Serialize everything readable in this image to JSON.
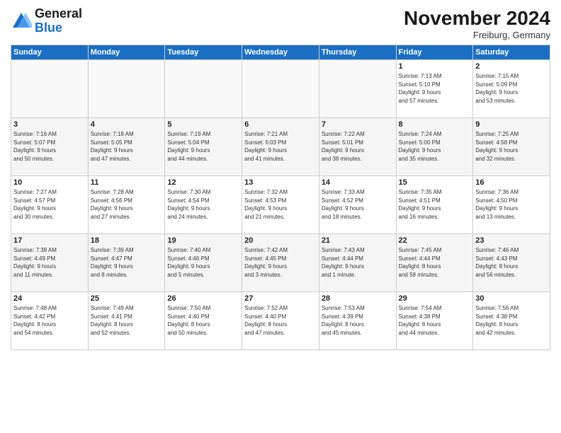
{
  "logo": {
    "line1": "General",
    "line2": "Blue"
  },
  "title": "November 2024",
  "subtitle": "Freiburg, Germany",
  "days_header": [
    "Sunday",
    "Monday",
    "Tuesday",
    "Wednesday",
    "Thursday",
    "Friday",
    "Saturday"
  ],
  "weeks": [
    [
      {
        "num": "",
        "info": ""
      },
      {
        "num": "",
        "info": ""
      },
      {
        "num": "",
        "info": ""
      },
      {
        "num": "",
        "info": ""
      },
      {
        "num": "",
        "info": ""
      },
      {
        "num": "1",
        "info": "Sunrise: 7:13 AM\nSunset: 5:10 PM\nDaylight: 9 hours\nand 57 minutes."
      },
      {
        "num": "2",
        "info": "Sunrise: 7:15 AM\nSunset: 5:09 PM\nDaylight: 9 hours\nand 53 minutes."
      }
    ],
    [
      {
        "num": "3",
        "info": "Sunrise: 7:16 AM\nSunset: 5:07 PM\nDaylight: 9 hours\nand 50 minutes."
      },
      {
        "num": "4",
        "info": "Sunrise: 7:18 AM\nSunset: 5:05 PM\nDaylight: 9 hours\nand 47 minutes."
      },
      {
        "num": "5",
        "info": "Sunrise: 7:19 AM\nSunset: 5:04 PM\nDaylight: 9 hours\nand 44 minutes."
      },
      {
        "num": "6",
        "info": "Sunrise: 7:21 AM\nSunset: 5:03 PM\nDaylight: 9 hours\nand 41 minutes."
      },
      {
        "num": "7",
        "info": "Sunrise: 7:22 AM\nSunset: 5:01 PM\nDaylight: 9 hours\nand 38 minutes."
      },
      {
        "num": "8",
        "info": "Sunrise: 7:24 AM\nSunset: 5:00 PM\nDaylight: 9 hours\nand 35 minutes."
      },
      {
        "num": "9",
        "info": "Sunrise: 7:25 AM\nSunset: 4:58 PM\nDaylight: 9 hours\nand 32 minutes."
      }
    ],
    [
      {
        "num": "10",
        "info": "Sunrise: 7:27 AM\nSunset: 4:57 PM\nDaylight: 9 hours\nand 30 minutes."
      },
      {
        "num": "11",
        "info": "Sunrise: 7:28 AM\nSunset: 4:56 PM\nDaylight: 9 hours\nand 27 minutes."
      },
      {
        "num": "12",
        "info": "Sunrise: 7:30 AM\nSunset: 4:54 PM\nDaylight: 9 hours\nand 24 minutes."
      },
      {
        "num": "13",
        "info": "Sunrise: 7:32 AM\nSunset: 4:53 PM\nDaylight: 9 hours\nand 21 minutes."
      },
      {
        "num": "14",
        "info": "Sunrise: 7:33 AM\nSunset: 4:52 PM\nDaylight: 9 hours\nand 18 minutes."
      },
      {
        "num": "15",
        "info": "Sunrise: 7:35 AM\nSunset: 4:51 PM\nDaylight: 9 hours\nand 16 minutes."
      },
      {
        "num": "16",
        "info": "Sunrise: 7:36 AM\nSunset: 4:50 PM\nDaylight: 9 hours\nand 13 minutes."
      }
    ],
    [
      {
        "num": "17",
        "info": "Sunrise: 7:38 AM\nSunset: 4:49 PM\nDaylight: 9 hours\nand 11 minutes."
      },
      {
        "num": "18",
        "info": "Sunrise: 7:39 AM\nSunset: 4:47 PM\nDaylight: 9 hours\nand 8 minutes."
      },
      {
        "num": "19",
        "info": "Sunrise: 7:40 AM\nSunset: 4:46 PM\nDaylight: 9 hours\nand 5 minutes."
      },
      {
        "num": "20",
        "info": "Sunrise: 7:42 AM\nSunset: 4:45 PM\nDaylight: 9 hours\nand 3 minutes."
      },
      {
        "num": "21",
        "info": "Sunrise: 7:43 AM\nSunset: 4:44 PM\nDaylight: 9 hours\nand 1 minute."
      },
      {
        "num": "22",
        "info": "Sunrise: 7:45 AM\nSunset: 4:44 PM\nDaylight: 8 hours\nand 58 minutes."
      },
      {
        "num": "23",
        "info": "Sunrise: 7:46 AM\nSunset: 4:43 PM\nDaylight: 8 hours\nand 56 minutes."
      }
    ],
    [
      {
        "num": "24",
        "info": "Sunrise: 7:48 AM\nSunset: 4:42 PM\nDaylight: 8 hours\nand 54 minutes."
      },
      {
        "num": "25",
        "info": "Sunrise: 7:49 AM\nSunset: 4:41 PM\nDaylight: 8 hours\nand 52 minutes."
      },
      {
        "num": "26",
        "info": "Sunrise: 7:50 AM\nSunset: 4:40 PM\nDaylight: 8 hours\nand 50 minutes."
      },
      {
        "num": "27",
        "info": "Sunrise: 7:52 AM\nSunset: 4:40 PM\nDaylight: 8 hours\nand 47 minutes."
      },
      {
        "num": "28",
        "info": "Sunrise: 7:53 AM\nSunset: 4:39 PM\nDaylight: 8 hours\nand 45 minutes."
      },
      {
        "num": "29",
        "info": "Sunrise: 7:54 AM\nSunset: 4:38 PM\nDaylight: 8 hours\nand 44 minutes."
      },
      {
        "num": "30",
        "info": "Sunrise: 7:56 AM\nSunset: 4:38 PM\nDaylight: 8 hours\nand 42 minutes."
      }
    ]
  ]
}
